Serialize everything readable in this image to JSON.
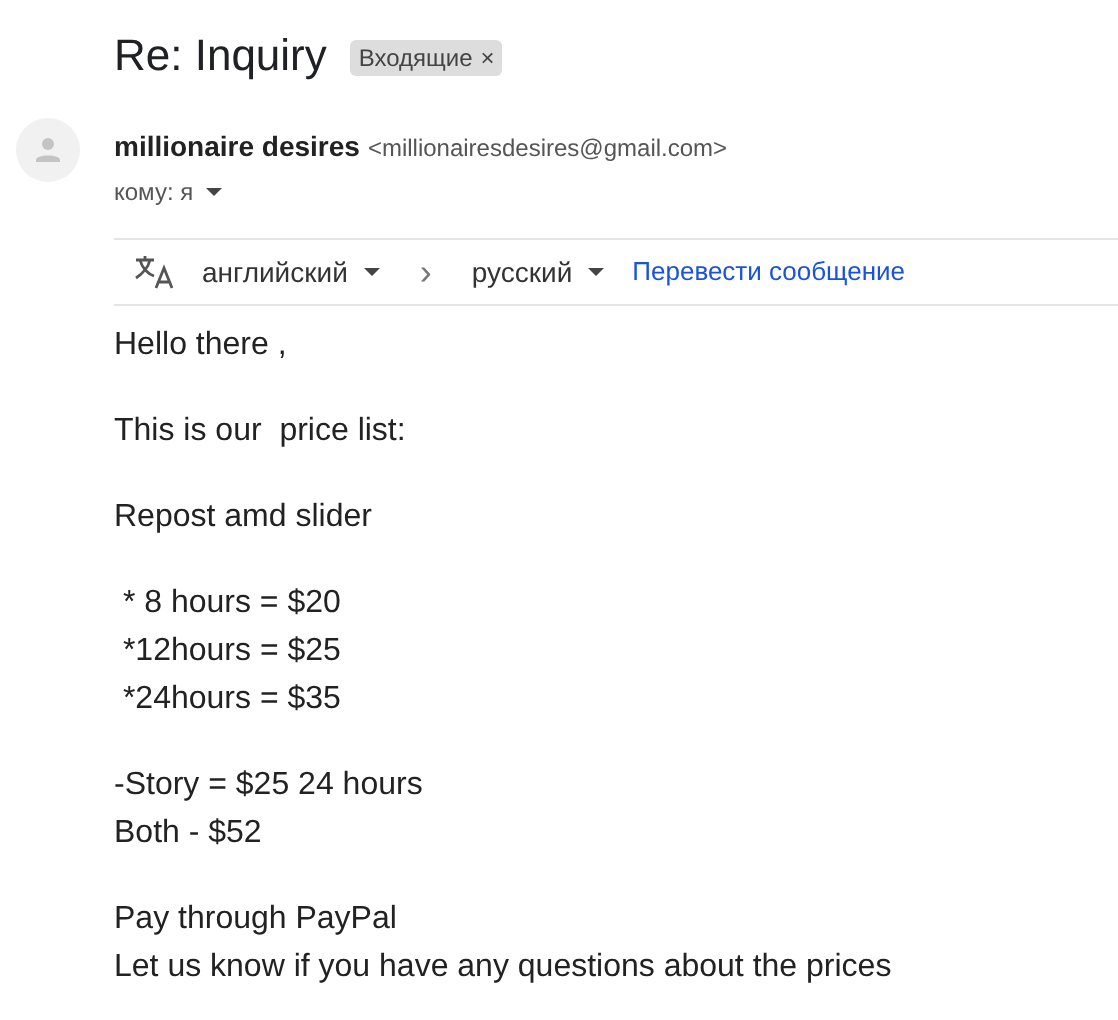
{
  "subject": "Re: Inquiry",
  "label": {
    "text": "Входящие",
    "close": "×"
  },
  "sender": {
    "name": "millionaire desires",
    "email": "<millionairesdesires@gmail.com>",
    "to": "кому: я"
  },
  "translate": {
    "from": "английский",
    "arrow": "›",
    "to": "русский",
    "action": "Перевести сообщение"
  },
  "body": [
    [
      "Hello there ,"
    ],
    [
      "This is our  price list:"
    ],
    [
      "Repost amd slider"
    ],
    [
      " * 8 hours = $20",
      " *12hours = $25",
      " *24hours = $35"
    ],
    [
      "-Story = $25 24 hours",
      "Both - $52"
    ],
    [
      "Pay through PayPal",
      "Let us know if you have any questions about the prices"
    ]
  ]
}
